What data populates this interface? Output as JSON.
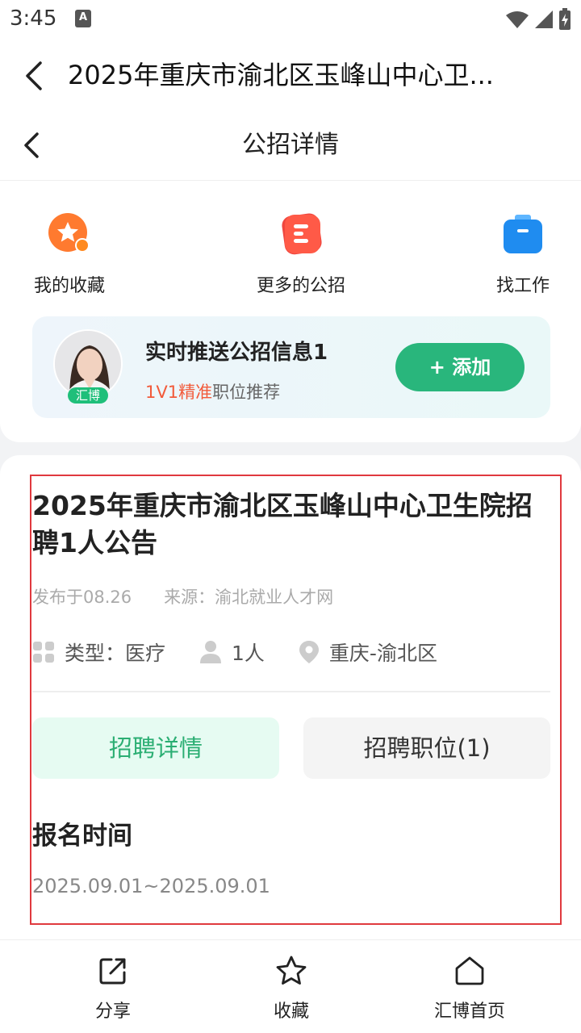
{
  "status_bar": {
    "time": "3:45",
    "ime_label": "A"
  },
  "app_bar": {
    "title": "2025年重庆市渝北区玉峰山中心卫..."
  },
  "inner_header": {
    "title": "公招详情"
  },
  "shortcuts": [
    {
      "label": "我的收藏",
      "icon": "star-badge-icon",
      "color": "#ff7a2f"
    },
    {
      "label": "更多的公招",
      "icon": "list-doc-icon",
      "color": "#f0473f"
    },
    {
      "label": "找工作",
      "icon": "briefcase-icon",
      "color": "#1f8cf0"
    }
  ],
  "promo": {
    "title": "实时推送公招信息1",
    "badge": "汇博",
    "sub_highlight": "1V1精准",
    "sub_rest": "职位推荐",
    "button": "+ 添加"
  },
  "job": {
    "title": "2025年重庆市渝北区玉峰山中心卫生院招聘1人公告",
    "published": "发布于08.26",
    "source": "来源：渝北就业人才网",
    "type": "类型：医疗",
    "count": "1人",
    "location": "重庆-渝北区",
    "tabs": [
      "招聘详情",
      "招聘职位(1)"
    ],
    "section_title": "报名时间",
    "section_value": "2025.09.01~2025.09.01"
  },
  "bottom_bar": [
    {
      "label": "分享",
      "icon": "share-icon"
    },
    {
      "label": "收藏",
      "icon": "star-icon"
    },
    {
      "label": "汇博首页",
      "icon": "home-icon"
    }
  ],
  "colors": {
    "accent_green": "#29b67c",
    "highlight_red": "#f25a3a",
    "annotation_red": "#e0393e"
  }
}
